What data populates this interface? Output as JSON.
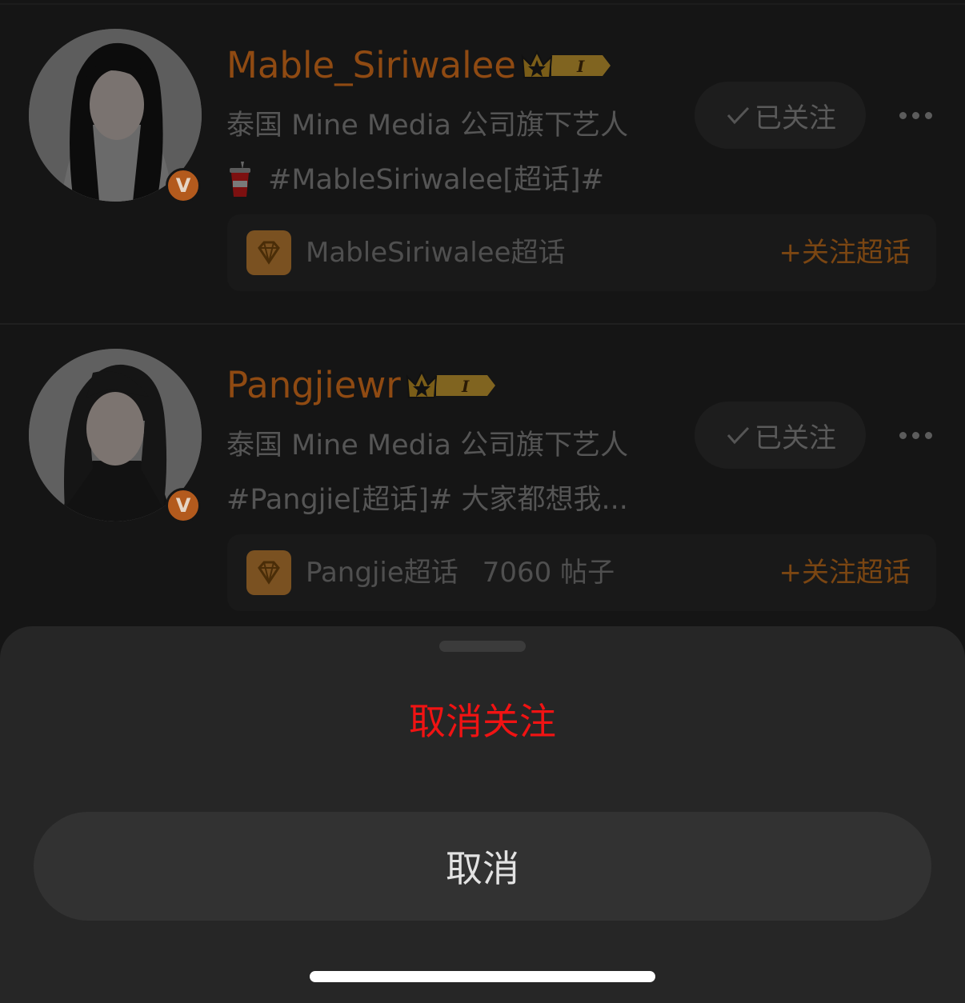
{
  "users": [
    {
      "username": "Mable_Siriwalee",
      "level_badge": "I",
      "verified": "V",
      "description": "泰国 Mine Media 公司旗下艺人",
      "topic": "#MableSiriwalee[超话]#",
      "follow_label": "已关注",
      "supertopic": {
        "name": "MableSiriwalee超话",
        "count": "",
        "follow_label": "+关注超话"
      }
    },
    {
      "username": "Pangjiewr",
      "level_badge": "I",
      "verified": "V",
      "description": "泰国 Mine Media 公司旗下艺人",
      "topic": "#Pangjie[超话]#  大家都想我...",
      "follow_label": "已关注",
      "supertopic": {
        "name": "Pangjie超话",
        "count": "7060 帖子",
        "follow_label": "+关注超话"
      }
    }
  ],
  "sheet": {
    "unfollow_label": "取消关注",
    "cancel_label": "取消"
  },
  "colors": {
    "username": "#8f4a12",
    "unfollow": "#f01313",
    "sheet_bg": "#262626"
  }
}
